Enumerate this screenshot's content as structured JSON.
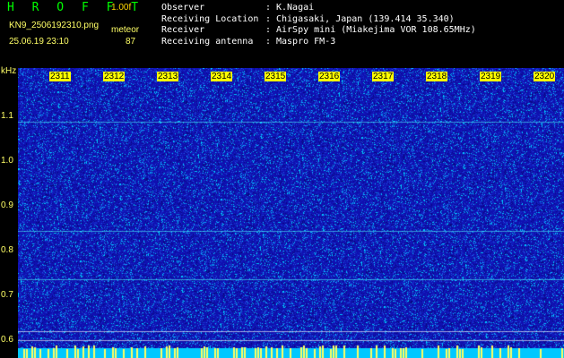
{
  "header": {
    "app_title": "H R O F F T",
    "version": "1.00f",
    "filename": "KN9_2506192310.png",
    "meteor_label": "meteor",
    "datetime": "25.06.19 23:10",
    "meteor_count": "87"
  },
  "info": [
    {
      "key": "Observer",
      "sep": ":",
      "value": "K.Nagai"
    },
    {
      "key": "Receiving Location",
      "sep": ":",
      "value": "Chigasaki, Japan (139.414 35.340)"
    },
    {
      "key": "Receiver",
      "sep": ":",
      "value": "AirSpy mini (Miakejima VOR 108.65MHz)"
    },
    {
      "key": "Receiving antenna",
      "sep": ":",
      "value": "Maspro FM-3"
    }
  ],
  "axis": {
    "unit": "kHz",
    "y_labels": [
      "1.1",
      "1.0",
      "0.9",
      "0.8",
      "0.7",
      "0.6"
    ],
    "x_labels": [
      "2311",
      "2312",
      "2313",
      "2314",
      "2315",
      "2316",
      "2317",
      "2318",
      "2319",
      "2320"
    ]
  },
  "colors": {
    "background": "#000000",
    "spectrum": "#1010b0",
    "noise": "#00c0ff",
    "line": "#40ffff",
    "label_yellow": "#ffff66",
    "title_green": "#00ff00"
  }
}
